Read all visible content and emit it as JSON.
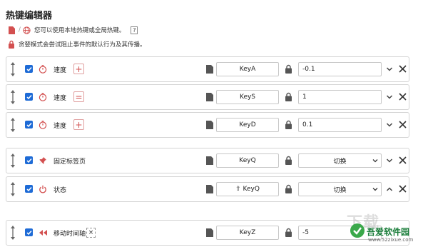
{
  "page_title": "热键编辑器",
  "info": {
    "line1": "您可以使用本地热键或全局热键。",
    "help_label": "?",
    "line2": "贪婪模式会尝试阻止事件的默认行为及其传播。"
  },
  "rows": [
    {
      "label": "速度",
      "op": "+",
      "key": "KeyA",
      "value": "-0.1",
      "icon": "timer-icon",
      "chevron": "down"
    },
    {
      "label": "速度",
      "op": "=",
      "key": "KeyS",
      "value": "1",
      "icon": "timer-icon",
      "chevron": "down"
    },
    {
      "label": "速度",
      "op": "+",
      "key": "KeyD",
      "value": "0.1",
      "icon": "timer-icon",
      "chevron": "down"
    },
    {
      "label": "固定标签页",
      "key": "KeyQ",
      "select": "切换",
      "icon": "pin-icon",
      "chevron": "down"
    },
    {
      "label": "状态",
      "key": "⇧ KeyQ",
      "select": "切换",
      "icon": "power-icon",
      "chevron": "up"
    },
    {
      "label": "移动时间轴",
      "extra": "×",
      "key": "KeyZ",
      "value": "-5",
      "icon": "rewind-icon",
      "chevron": "down"
    }
  ],
  "watermark": {
    "brand": "吾爱软件园",
    "url": "www.52zixue.com",
    "big": "下载"
  },
  "colors": {
    "accent": "#1e6bd6",
    "danger": "#d35050",
    "border": "#d4d4d4"
  }
}
